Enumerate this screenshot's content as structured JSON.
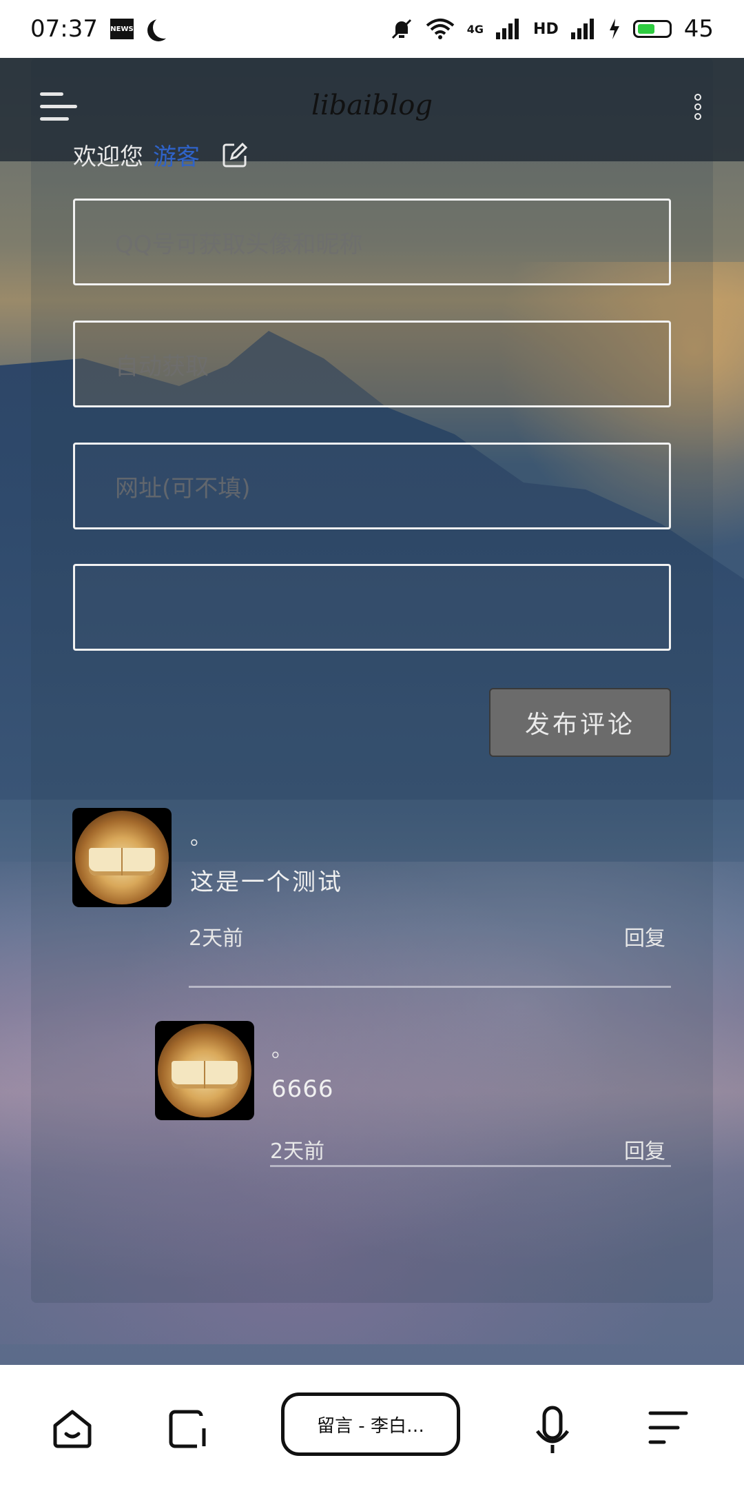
{
  "statusbar": {
    "time": "07:37",
    "news_label": "NEWS",
    "network_label": "4G",
    "hd_label": "HD",
    "battery_level": "45"
  },
  "header": {
    "brand": "libaiblog"
  },
  "form": {
    "welcome_prefix": "欢迎您",
    "welcome_user": "游客",
    "qq_placeholder": "QQ号可获取头像和昵称",
    "name_placeholder": "自动获取",
    "url_placeholder": "网址(可不填)",
    "comment_placeholder": "",
    "submit_label": "发布评论"
  },
  "comments": [
    {
      "name": "。",
      "text": "这是一个测试",
      "time": "2天前",
      "reply_label": "回复"
    },
    {
      "name": "。",
      "text": "6666",
      "time": "2天前",
      "reply_label": "回复"
    }
  ],
  "bottom_nav": {
    "title": "留言 - 李白…",
    "icons": [
      "home-icon",
      "tabs-icon",
      "voice-icon",
      "menu-icon"
    ]
  },
  "colors": {
    "guest_link": "#2f63c9",
    "submit_bg": "#6b6b6b"
  }
}
